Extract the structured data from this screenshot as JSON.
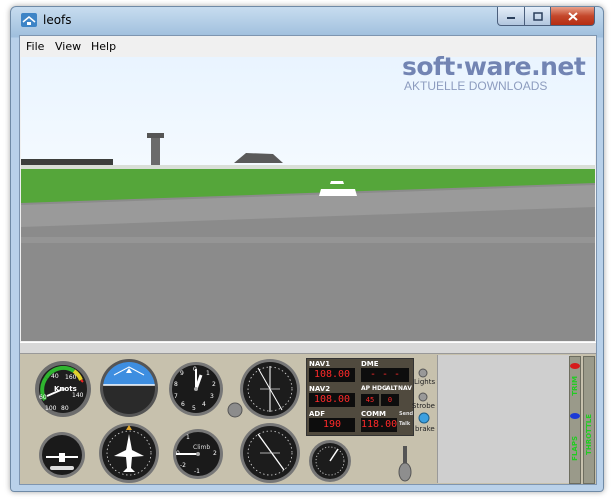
{
  "window": {
    "title": "leofs"
  },
  "menu": {
    "items": [
      "File",
      "View",
      "Help"
    ]
  },
  "watermark": {
    "main": "soft·ware.net",
    "sub": "AKTUELLE DOWNLOADS"
  },
  "instruments": {
    "airspeed_label": "Knots",
    "airspeed_ticks": [
      "40",
      "160",
      "140",
      "60",
      "100",
      "80"
    ],
    "altimeter_ticks": [
      "0",
      "1",
      "2",
      "3",
      "4",
      "5",
      "6",
      "7",
      "8",
      "9"
    ],
    "vsi_label": "Climb",
    "vsi_ticks": [
      "1",
      "2",
      "-1",
      "-2",
      "0"
    ]
  },
  "radios": {
    "nav1_label": "NAV1",
    "nav1_value": "108.00",
    "dme_label": "DME",
    "dme_value": "- - -",
    "nav2_label": "NAV2",
    "nav2_value": "108.00",
    "ap_buttons": [
      "AP",
      "HDG",
      "ALT",
      "NAV"
    ],
    "ap_hdg_value": "45",
    "ap_alt_value": "0",
    "adf_label": "ADF",
    "adf_value": "190",
    "comm_label": "COMM",
    "comm_value": "118.00",
    "send_label": "Send",
    "talk_label": "Talk"
  },
  "switches": {
    "lights": "Lights",
    "strobe": "Strobe",
    "brake": "brake"
  },
  "sliders": {
    "flaps": "FLAPS",
    "trim": "TRIM",
    "throttle": "THROTTLE"
  },
  "colors": {
    "sky": "#e8f3ff",
    "grass": "#55a63a",
    "runway": "#8a8a8a",
    "panel": "#c7c1ad",
    "radio_red": "#ff2a2a"
  }
}
